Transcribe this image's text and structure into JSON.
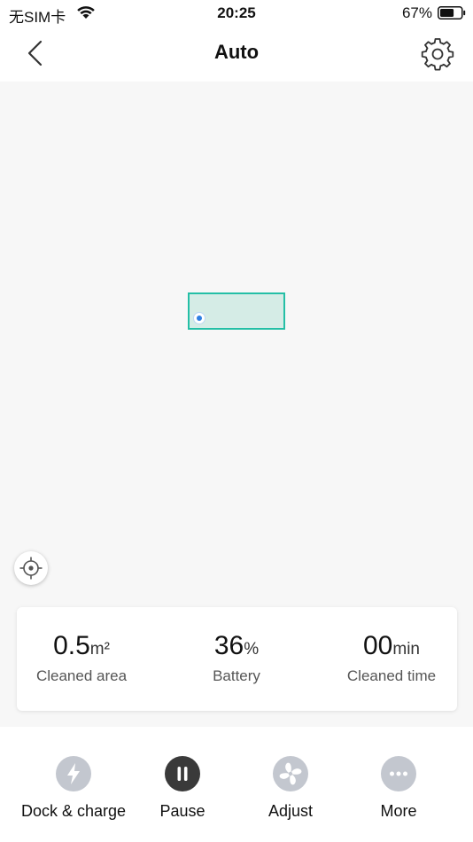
{
  "status_bar": {
    "carrier": "无SIM卡",
    "time": "20:25",
    "battery_percent": "67%",
    "battery_level": 0.67
  },
  "header": {
    "title": "Auto",
    "back_icon": "chevron-left-icon",
    "settings_icon": "gear-icon"
  },
  "stats": {
    "area": {
      "value": "0.5",
      "unit": "m²",
      "label": "Cleaned area"
    },
    "battery": {
      "value": "36",
      "unit": "%",
      "label": "Battery"
    },
    "time": {
      "value": "00",
      "unit": "min",
      "label": "Cleaned time"
    }
  },
  "actions": [
    {
      "label": "Dock & charge",
      "icon": "lightning-icon"
    },
    {
      "label": "Pause",
      "icon": "pause-icon"
    },
    {
      "label": "Adjust",
      "icon": "fan-icon"
    },
    {
      "label": "More",
      "icon": "more-dots-icon"
    }
  ],
  "colors": {
    "accent": "#24bfa6",
    "room_fill": "#d5ece6",
    "robot": "#2f7fe4",
    "icon_inactive": "#c3c7cf",
    "icon_active": "#3a3a3a"
  }
}
